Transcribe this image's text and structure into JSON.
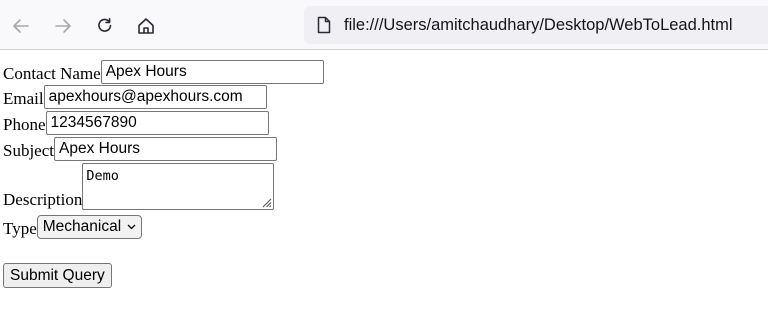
{
  "browser": {
    "url": "file:///Users/amitchaudhary/Desktop/WebToLead.html",
    "icons": [
      "back-arrow-icon",
      "forward-arrow-icon",
      "reload-icon",
      "home-icon",
      "document-icon"
    ]
  },
  "form": {
    "contact_name": {
      "label": "Contact Name",
      "value": "Apex Hours"
    },
    "email": {
      "label": "Email",
      "value": "apexhours@apexhours.com"
    },
    "phone": {
      "label": "Phone",
      "value": "1234567890"
    },
    "subject": {
      "label": "Subject",
      "value": "Apex Hours"
    },
    "description": {
      "label": "Description",
      "value": "Demo"
    },
    "type": {
      "label": "Type",
      "selected": "Mechanical"
    },
    "submit_label": "Submit Query"
  }
}
